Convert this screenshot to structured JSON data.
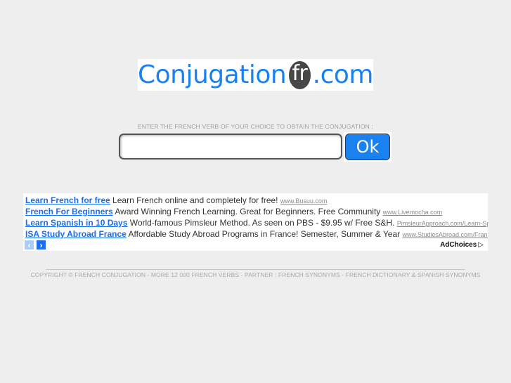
{
  "logo": {
    "prefix": "Conjugation",
    "badge": "fr",
    "suffix": ".com",
    "brand_color": "#1a82f0"
  },
  "search": {
    "prompt": "ENTER THE FRENCH VERB OF YOUR CHOICE TO OBTAIN THE CONJUGATION :",
    "value": "",
    "placeholder": "",
    "button_label": "Ok"
  },
  "ads": {
    "items": [
      {
        "title": "Learn French for free",
        "text": "Learn French online and completely for free!",
        "url": "www.Busuu.com"
      },
      {
        "title": "French For Beginners",
        "text": "Award Winning French Learning. Great for Beginners. Free Community",
        "url": "www.Livemocha.com"
      },
      {
        "title": "Learn Spanish in 10 Days",
        "text": "World-famous Pimsleur Method. As seen on PBS - $9.95 w/ Free S&H.",
        "url": "PimsleurApproach.com/Learn-Spanish"
      },
      {
        "title": "ISA Study Abroad France",
        "text": "Affordable Study Abroad Programs in France! Semester, Summer & Year",
        "url": "www.StudiesAbroad.com/France"
      }
    ],
    "prev_icon": "‹",
    "next_icon": "›",
    "adchoices_label": "AdChoices",
    "adchoices_icon": "▷"
  },
  "footer": {
    "copyright": "COPYRIGHT © FRENCH CONJUGATION - MORE 12 000 FRENCH VERBS - PARTNER : ",
    "link_synonyms": "FRENCH SYNONYMS",
    "sep1": " - ",
    "link_dictionary": "FRENCH DICTIONARY",
    "sep2": " & ",
    "link_spanish": "SPANISH SYNONYMS"
  }
}
